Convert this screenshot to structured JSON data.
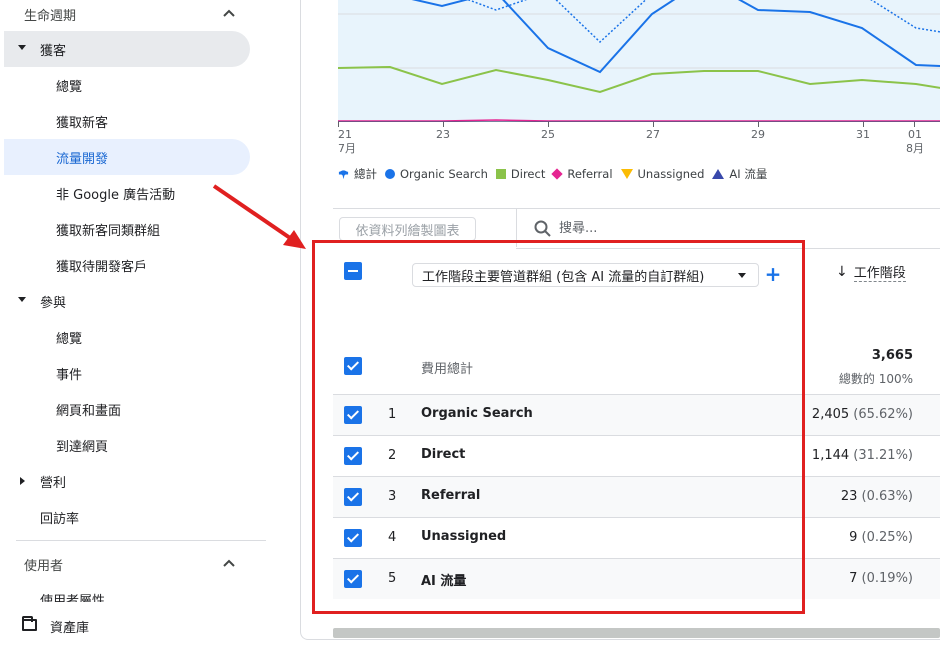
{
  "sidebar": {
    "section_lifecycle": "生命週期",
    "acquisition": {
      "label": "獲客",
      "items": [
        "總覽",
        "獲取新客",
        "流量開發",
        "非 Google 廣告活動",
        "獲取新客同類群組",
        "獲取待開發客戶"
      ],
      "selected_index": 2
    },
    "engagement": {
      "label": "參與",
      "items": [
        "總覽",
        "事件",
        "網頁和畫面",
        "到達網頁"
      ]
    },
    "monetization": "營利",
    "retention": "回訪率",
    "section_user": "使用者",
    "user_attributes_cut": "使用者屬性",
    "library": "資產庫"
  },
  "chart_data": {
    "type": "line",
    "x_tick_labels": [
      "21",
      "23",
      "25",
      "27",
      "29",
      "31",
      "01"
    ],
    "x_sub_labels": [
      "7月",
      "8月"
    ],
    "legend": [
      {
        "name": "總計",
        "marker": "total-icon",
        "color": "#1a73e8"
      },
      {
        "name": "Organic Search",
        "marker": "circle",
        "color": "#1a73e8"
      },
      {
        "name": "Direct",
        "marker": "square",
        "color": "#8bc34a"
      },
      {
        "name": "Referral",
        "marker": "diamond",
        "color": "#e52592"
      },
      {
        "name": "Unassigned",
        "marker": "triangle-down",
        "color": "#fbbc04"
      },
      {
        "name": "AI 流量",
        "marker": "triangle-up",
        "color": "#3949ab"
      }
    ]
  },
  "toolbar": {
    "plot_rows_label": "依資料列繪製圖表",
    "search_placeholder": "搜尋..."
  },
  "table": {
    "dimension_select": "工作階段主要管道群組 (包含 AI 流量的自訂群組)",
    "add_dimension": "+",
    "metric_header": "工作階段",
    "metric_sort_arrow": "↓",
    "total_label": "費用總計",
    "total_value": "3,665",
    "total_pct": "總數的 100%",
    "rows": [
      {
        "idx": "1",
        "name": "Organic Search",
        "value": "2,405",
        "pct": "(65.62%)"
      },
      {
        "idx": "2",
        "name": "Direct",
        "value": "1,144",
        "pct": "(31.21%)"
      },
      {
        "idx": "3",
        "name": "Referral",
        "value": "23",
        "pct": "(0.63%)"
      },
      {
        "idx": "4",
        "name": "Unassigned",
        "value": "9",
        "pct": "(0.25%)"
      },
      {
        "idx": "5",
        "name": "AI 流量",
        "value": "7",
        "pct": "(0.19%)"
      }
    ]
  },
  "colors": {
    "accent": "#1a73e8",
    "annotation_red": "#e02020",
    "selected_bg": "#e8f0fe"
  }
}
